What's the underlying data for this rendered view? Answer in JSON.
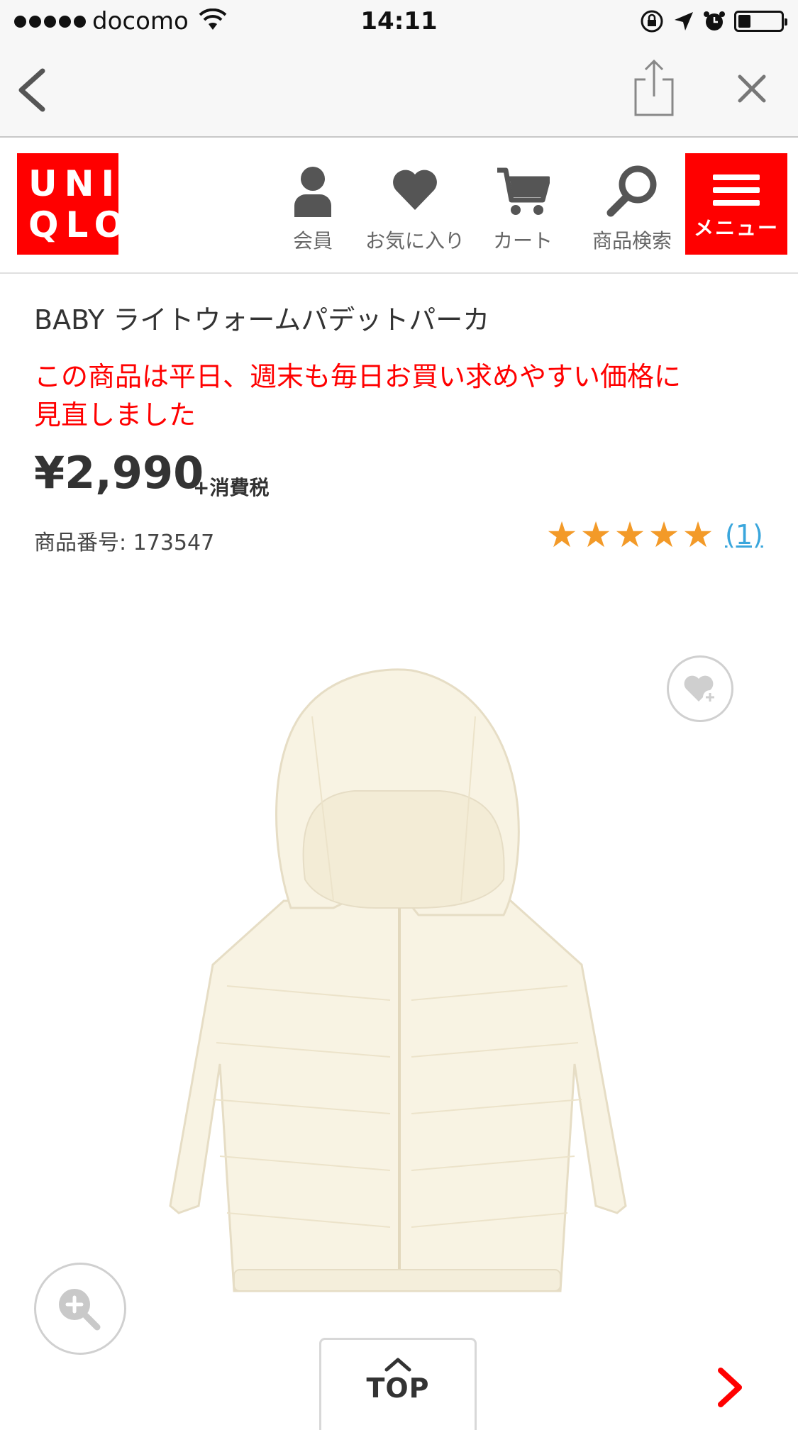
{
  "status_bar": {
    "carrier": "docomo",
    "time": "14:11",
    "signal_bars": 5,
    "battery_level": 0.3
  },
  "browser": {
    "back_icon": "chevron-left-icon",
    "share_icon": "share-icon",
    "close_icon": "close-icon"
  },
  "header": {
    "logo_line1": "UNI",
    "logo_line2": "QLO",
    "brand_color": "#ff0000",
    "nav": [
      {
        "label": "会員",
        "icon": "person-icon"
      },
      {
        "label": "お気に入り",
        "icon": "heart-icon"
      },
      {
        "label": "カート",
        "icon": "cart-icon"
      },
      {
        "label": "商品検索",
        "icon": "search-icon"
      }
    ],
    "menu_label": "メニュー"
  },
  "product": {
    "title": "BABY ライトウォームパデットパーカ",
    "promo_line1": "この商品は平日、週末も毎日お買い求めやすい価格に",
    "promo_line2": "見直しました",
    "price": "¥2,990",
    "tax_note": "+消費税",
    "product_number": "商品番号: 173547",
    "rating_stars": 5,
    "review_count": "(1)"
  },
  "colors": {
    "accent_red": "#ff0000",
    "star_orange": "#f39a28",
    "link_blue": "#3aa6dc"
  },
  "footer": {
    "top_label": "TOP"
  }
}
